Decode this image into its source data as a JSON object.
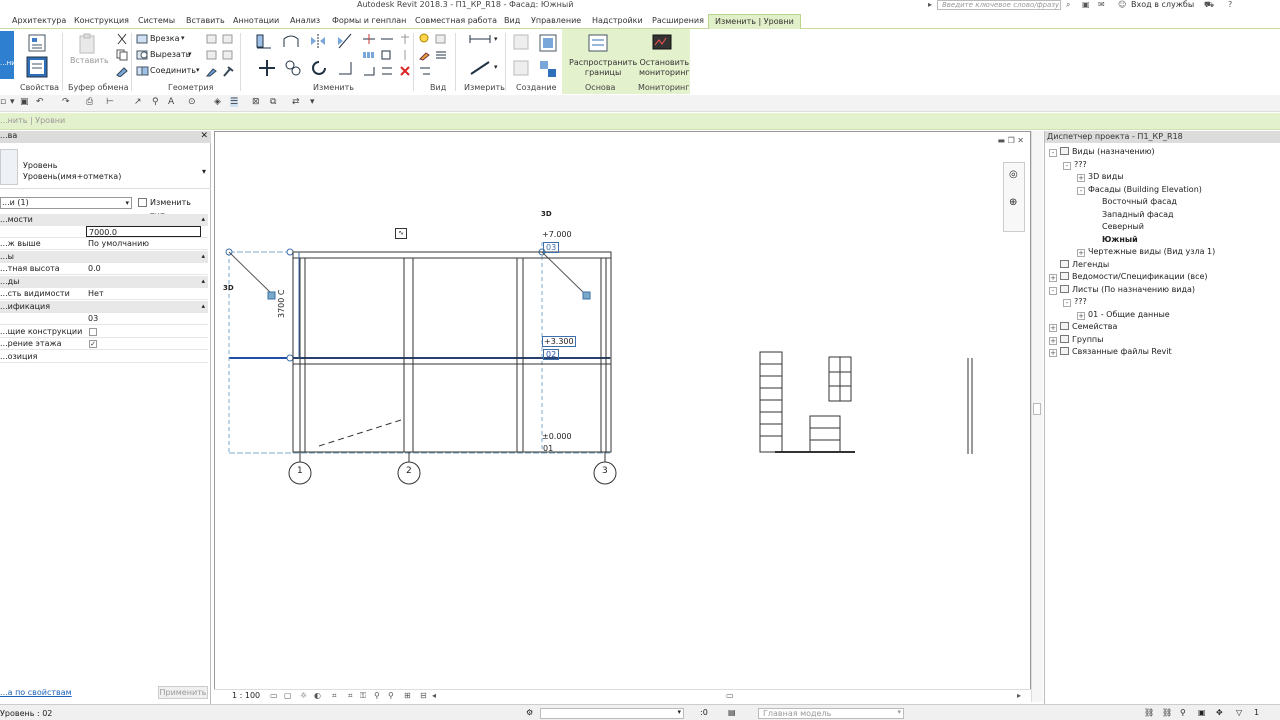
{
  "app": {
    "title": "Autodesk Revit 2018.3 -    П1_КР_R18 - Фасад: Южный",
    "search_placeholder": "Введите ключевое слово/фразу",
    "sign_in": "Вход в службы"
  },
  "ribbon_tabs": [
    {
      "label": "Архитектура"
    },
    {
      "label": "Конструкция"
    },
    {
      "label": "Системы"
    },
    {
      "label": "Вставить"
    },
    {
      "label": "Аннотации"
    },
    {
      "label": "Анализ"
    },
    {
      "label": "Формы и генплан"
    },
    {
      "label": "Совместная работа"
    },
    {
      "label": "Вид"
    },
    {
      "label": "Управление"
    },
    {
      "label": "Надстройки"
    },
    {
      "label": "Расширения"
    },
    {
      "label": "Изменить | Уровни"
    }
  ],
  "ribbon": {
    "modify_btn": "...нить",
    "paste": "Вставить",
    "cut_join": "Врезка",
    "cut": "Вырезать",
    "join": "Соединить",
    "propagate_l1": "Распространить",
    "propagate_l2": "границы",
    "stop_l1": "Остановить",
    "stop_l2": "мониторинг",
    "panels": {
      "properties": "Свойства",
      "clipboard": "Буфер обмена",
      "geometry": "Геометрия",
      "modify": "Изменить",
      "view": "Вид",
      "measure": "Измерить",
      "create": "Создание",
      "basis": "Основа",
      "monitoring": "Мониторинг"
    }
  },
  "options_bar": {
    "context": "...нить | Уровни"
  },
  "properties": {
    "header": "...ва",
    "type_line1": "Уровень",
    "type_line2": "Уровень(имя+отметка)",
    "instance_filter": "...и (1)",
    "edit_type": "Изменить тип",
    "rows": [
      {
        "name": "...мости",
        "value": "",
        "group": true
      },
      {
        "name": "",
        "value": "7000.0",
        "boxed": true
      },
      {
        "name": "...ж выше",
        "value": "По умолчанию"
      },
      {
        "name": "...ы",
        "value": "",
        "group": true
      },
      {
        "name": "...тная высота",
        "value": "0.0"
      },
      {
        "name": "...ды",
        "value": "",
        "group": true
      },
      {
        "name": "...сть видимости",
        "value": "Нет"
      },
      {
        "name": "...ификация",
        "value": "",
        "group": true
      },
      {
        "name": "",
        "value": "03"
      },
      {
        "name": "...щие конструкции",
        "value": "",
        "checkbox": false
      },
      {
        "name": "...рение этажа",
        "value": "",
        "checkbox": true
      },
      {
        "name": "...озиция",
        "value": ""
      }
    ],
    "help_link": "...а по свойствам",
    "apply": "Применить"
  },
  "drawing": {
    "levels": [
      {
        "name": "03",
        "elevation": "+7.000"
      },
      {
        "name": "02",
        "elevation": "+3.300"
      },
      {
        "name": "01",
        "elevation": "±0.000"
      }
    ],
    "grids": [
      "1",
      "2",
      "3"
    ],
    "dimension": "3700 С",
    "tag_3d": "3D"
  },
  "view_control": {
    "scale": "1 : 100"
  },
  "project_browser": {
    "header": "Диспетчер проекта - П1_КР_R18",
    "nodes": [
      {
        "label": "Виды (назначению)",
        "toggle": "-",
        "indent": 0,
        "icon": true
      },
      {
        "label": "???",
        "toggle": "-",
        "indent": 1
      },
      {
        "label": "3D виды",
        "toggle": "+",
        "indent": 2
      },
      {
        "label": "Фасады (Building Elevation)",
        "toggle": "-",
        "indent": 2
      },
      {
        "label": "Восточный фасад",
        "indent": 3
      },
      {
        "label": "Западный фасад",
        "indent": 3
      },
      {
        "label": "Северный",
        "indent": 3
      },
      {
        "label": "Южный",
        "indent": 3,
        "bold": true
      },
      {
        "label": "Чертежные виды (Вид узла 1)",
        "toggle": "+",
        "indent": 2
      },
      {
        "label": "Легенды",
        "indent": 0,
        "icon": true
      },
      {
        "label": "Ведомости/Спецификации (все)",
        "toggle": "+",
        "indent": 0,
        "icon": true
      },
      {
        "label": "Листы (По назначению вида)",
        "toggle": "-",
        "indent": 0,
        "icon": true
      },
      {
        "label": "???",
        "toggle": "-",
        "indent": 1
      },
      {
        "label": "01 - Общие данные",
        "toggle": "+",
        "indent": 2
      },
      {
        "label": "Семейства",
        "toggle": "+",
        "indent": 0,
        "icon": true
      },
      {
        "label": "Группы",
        "toggle": "+",
        "indent": 0,
        "icon": true
      },
      {
        "label": "Связанные файлы Revit",
        "toggle": "+",
        "indent": 0,
        "icon": true
      }
    ]
  },
  "status_bar": {
    "status": "Уровень : 02",
    "zero": ":0",
    "model": "Главная модель",
    "filter": "1"
  },
  "colors": {
    "accent_green": "#e4f1cd",
    "selection_blue": "#1f4ea8"
  }
}
